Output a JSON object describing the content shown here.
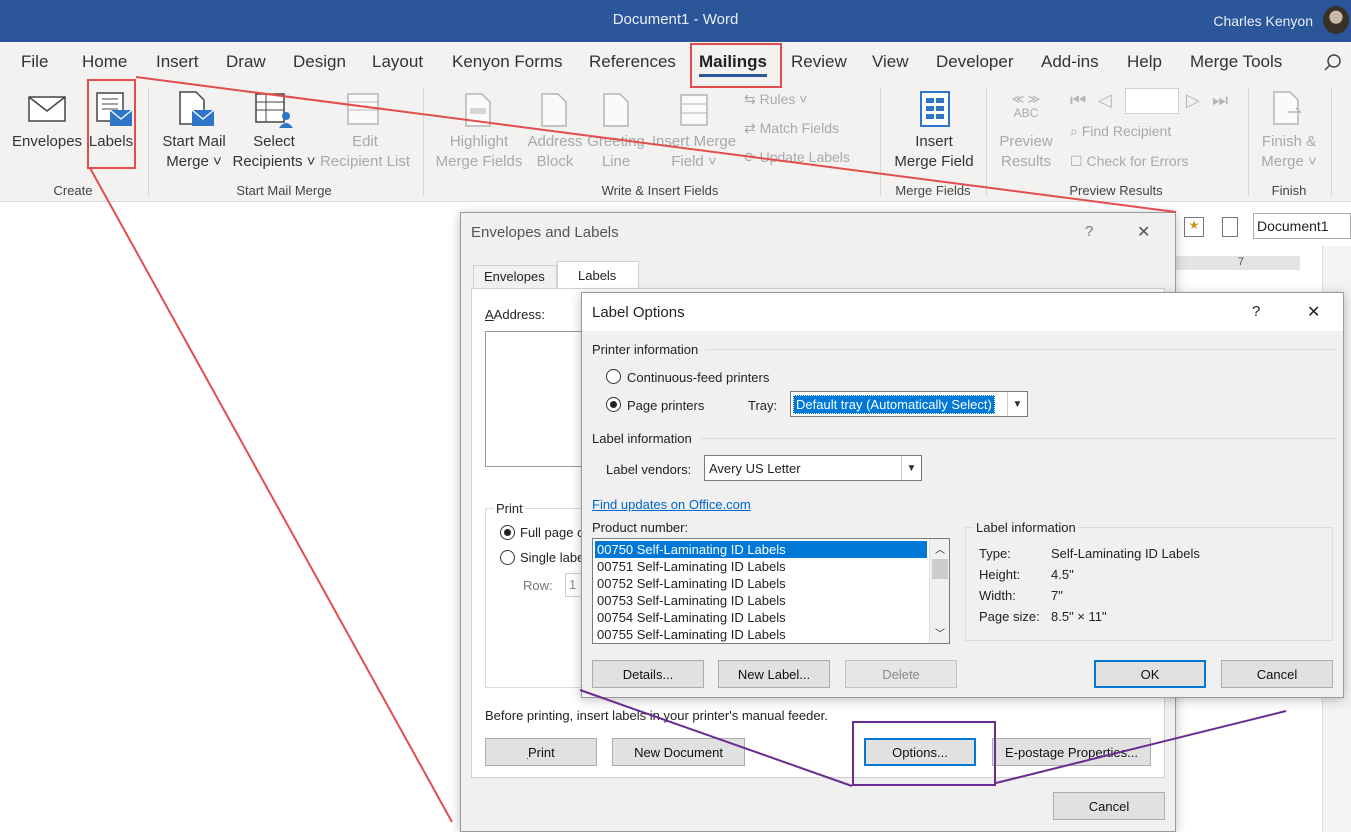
{
  "window": {
    "title": "Document1  -  Word",
    "user": "Charles Kenyon"
  },
  "tabs": [
    "File",
    "Home",
    "Insert",
    "Draw",
    "Design",
    "Layout",
    "Kenyon Forms",
    "References",
    "Mailings",
    "Review",
    "View",
    "Developer",
    "Add-ins",
    "Help",
    "Merge Tools"
  ],
  "active_tab": "Mailings",
  "ribbon": {
    "create": {
      "envelopes": "Envelopes",
      "labels": "Labels",
      "group": "Create"
    },
    "start": {
      "start_l1": "Start Mail",
      "start_l2": "Merge",
      "select_l1": "Select",
      "select_l2": "Recipients",
      "edit_l1": "Edit",
      "edit_l2": "Recipient List",
      "group": "Start Mail Merge"
    },
    "write": {
      "highlight_l1": "Highlight",
      "highlight_l2": "Merge Fields",
      "address_l1": "Address",
      "address_l2": "Block",
      "greeting_l1": "Greeting",
      "greeting_l2": "Line",
      "insert_l1": "Insert Merge",
      "insert_l2": "Field",
      "rules": "Rules",
      "match": "Match Fields",
      "update": "Update Labels",
      "group": "Write & Insert Fields"
    },
    "merge_fields": {
      "l1": "Insert",
      "l2": "Merge Field",
      "group": "Merge Fields"
    },
    "preview": {
      "l1": "Preview",
      "l2": "Results",
      "abc": "ABC",
      "find": "Find Recipient",
      "check": "Check for Errors",
      "group": "Preview Results"
    },
    "finish": {
      "l1": "Finish &",
      "l2": "Merge",
      "group": "Finish"
    }
  },
  "side": {
    "doc_name": "Document1",
    "ruler_num": "7"
  },
  "env_dialog": {
    "title": "Envelopes and Labels",
    "help": "?",
    "close": "✕",
    "tab_envelopes": "Envelopes",
    "tab_labels": "Labels",
    "address_label": "Address:",
    "print_group": "Print",
    "full_page": "Full page o",
    "single_label": "Single labe",
    "row_label": "Row:",
    "row_value": "1",
    "note": "Before printing, insert labels in your printer's manual feeder.",
    "btn_print": "Print",
    "btn_new_doc": "New Document",
    "btn_options": "Options...",
    "btn_epostage": "E-postage Properties...",
    "btn_cancel": "Cancel"
  },
  "label_options": {
    "title": "Label Options",
    "help": "?",
    "close": "✕",
    "printer_info": "Printer information",
    "continuous": "Continuous-feed printers",
    "page_printers": "Page printers",
    "tray_label": "Tray:",
    "tray_value": "Default tray (Automatically Select)",
    "label_info": "Label information",
    "vendors_label": "Label vendors:",
    "vendor_value": "Avery US Letter",
    "find_updates": "Find updates on Office.com",
    "product_number": "Product number:",
    "products": [
      "00750 Self-Laminating ID Labels",
      "00751 Self-Laminating ID Labels",
      "00752 Self-Laminating ID Labels",
      "00753 Self-Laminating ID Labels",
      "00754 Self-Laminating ID Labels",
      "00755 Self-Laminating ID Labels"
    ],
    "selected_index": 0,
    "info_group": "Label information",
    "type_label": "Type:",
    "type_value": "Self-Laminating ID Labels",
    "height_label": "Height:",
    "height_value": "4.5\"",
    "width_label": "Width:",
    "width_value": "7\"",
    "page_size_label": "Page size:",
    "page_size_value": "8.5\" × 11\"",
    "btn_details": "Details...",
    "btn_new_label": "New Label...",
    "btn_delete": "Delete",
    "btn_ok": "OK",
    "btn_cancel": "Cancel"
  },
  "colors": {
    "title_bar": "#2b579a",
    "callout_red": "#e34d4d",
    "callout_purple": "#6b2c91",
    "selection": "#0078d7"
  }
}
